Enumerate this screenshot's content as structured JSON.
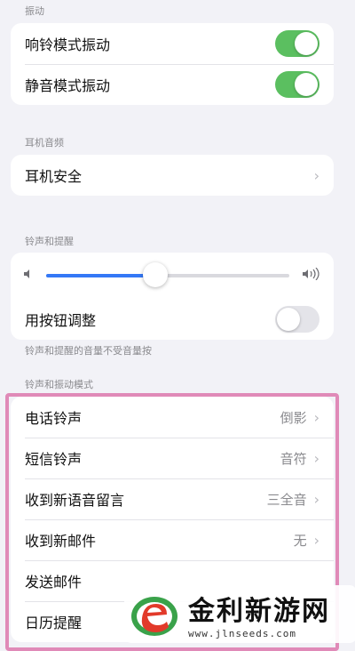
{
  "sections": {
    "vibration": "振动",
    "headphone_audio": "耳机音频",
    "ringtone_alerts": "铃声和提醒",
    "ringtone_vibration_patterns": "铃声和振动模式"
  },
  "vibration": {
    "ring_vibrate": {
      "label": "响铃模式振动",
      "on": true
    },
    "silent_vibrate": {
      "label": "静音模式振动",
      "on": true
    }
  },
  "headphone": {
    "safety_label": "耳机安全"
  },
  "ringer": {
    "volume_fraction": 0.45,
    "change_with_buttons": {
      "label": "用按钮调整",
      "on": false
    },
    "note": "铃声和提醒的音量不受音量按"
  },
  "patterns": [
    {
      "label": "电话铃声",
      "value": "倒影"
    },
    {
      "label": "短信铃声",
      "value": "音符"
    },
    {
      "label": "收到新语音留言",
      "value": "三全音"
    },
    {
      "label": "收到新邮件",
      "value": "无"
    },
    {
      "label": "发送邮件",
      "value": ""
    },
    {
      "label": "日历提醒",
      "value": ""
    }
  ],
  "watermark": {
    "title": "金利新游网",
    "url": "www.jlnseeds.com"
  },
  "colors": {
    "toggle_on": "#5bbf60",
    "slider_fill": "#3478f6",
    "highlight_border": "#e08ab8"
  }
}
